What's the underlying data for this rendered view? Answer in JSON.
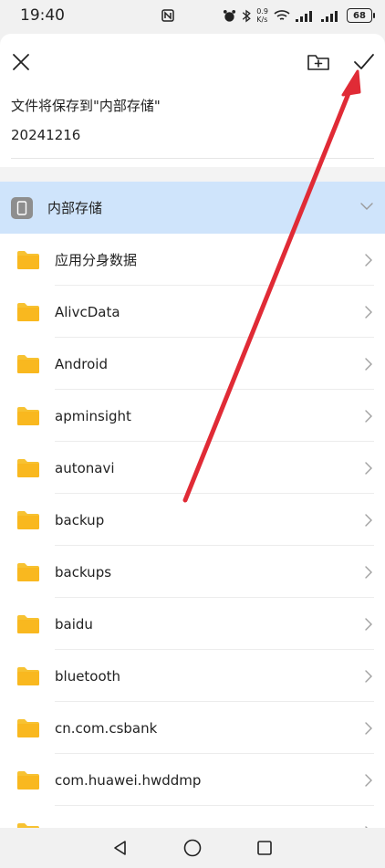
{
  "status_bar": {
    "time": "19:40",
    "net_speed_top": "0.9",
    "net_speed_unit": "K/s",
    "battery": "68"
  },
  "dialog": {
    "save_to_text": "文件将保存到\"内部存储\"",
    "file_name_value": "20241216"
  },
  "storage": {
    "label": "内部存储"
  },
  "folders": [
    "应用分身数据",
    "AlivcData",
    "Android",
    "apminsight",
    "autonavi",
    "backup",
    "backups",
    "baidu",
    "bluetooth",
    "cn.com.csbank",
    "com.huawei.hwddmp",
    ""
  ],
  "colors": {
    "folder": "#f7c232",
    "highlight": "#cfe4fb",
    "arrow": "#e02b36"
  },
  "icons": [
    "close-icon",
    "new-folder-icon",
    "check-icon",
    "phone-icon",
    "chevron-down-icon",
    "chevron-right-icon",
    "back-nav-icon",
    "home-nav-icon",
    "recents-nav-icon"
  ]
}
